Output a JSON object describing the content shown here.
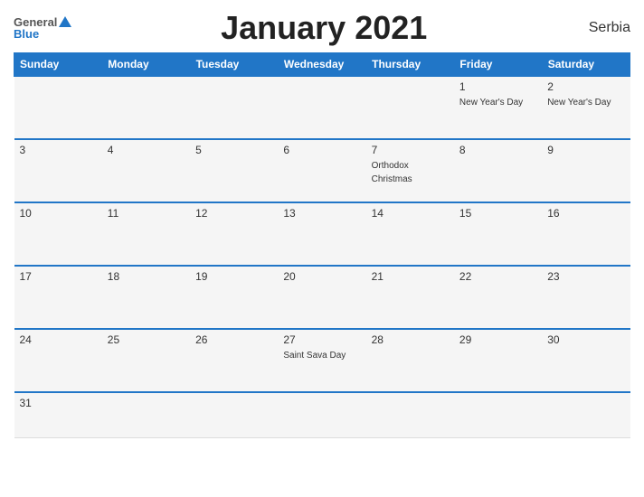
{
  "header": {
    "logo_general": "General",
    "logo_blue": "Blue",
    "title": "January 2021",
    "country": "Serbia"
  },
  "calendar": {
    "days_of_week": [
      "Sunday",
      "Monday",
      "Tuesday",
      "Wednesday",
      "Thursday",
      "Friday",
      "Saturday"
    ],
    "weeks": [
      [
        {
          "day": "",
          "event": ""
        },
        {
          "day": "",
          "event": ""
        },
        {
          "day": "",
          "event": ""
        },
        {
          "day": "",
          "event": ""
        },
        {
          "day": "",
          "event": ""
        },
        {
          "day": "1",
          "event": "New Year's Day"
        },
        {
          "day": "2",
          "event": "New Year's Day"
        }
      ],
      [
        {
          "day": "3",
          "event": ""
        },
        {
          "day": "4",
          "event": ""
        },
        {
          "day": "5",
          "event": ""
        },
        {
          "day": "6",
          "event": ""
        },
        {
          "day": "7",
          "event": "Orthodox Christmas"
        },
        {
          "day": "8",
          "event": ""
        },
        {
          "day": "9",
          "event": ""
        }
      ],
      [
        {
          "day": "10",
          "event": ""
        },
        {
          "day": "11",
          "event": ""
        },
        {
          "day": "12",
          "event": ""
        },
        {
          "day": "13",
          "event": ""
        },
        {
          "day": "14",
          "event": ""
        },
        {
          "day": "15",
          "event": ""
        },
        {
          "day": "16",
          "event": ""
        }
      ],
      [
        {
          "day": "17",
          "event": ""
        },
        {
          "day": "18",
          "event": ""
        },
        {
          "day": "19",
          "event": ""
        },
        {
          "day": "20",
          "event": ""
        },
        {
          "day": "21",
          "event": ""
        },
        {
          "day": "22",
          "event": ""
        },
        {
          "day": "23",
          "event": ""
        }
      ],
      [
        {
          "day": "24",
          "event": ""
        },
        {
          "day": "25",
          "event": ""
        },
        {
          "day": "26",
          "event": ""
        },
        {
          "day": "27",
          "event": "Saint Sava Day"
        },
        {
          "day": "28",
          "event": ""
        },
        {
          "day": "29",
          "event": ""
        },
        {
          "day": "30",
          "event": ""
        }
      ],
      [
        {
          "day": "31",
          "event": ""
        },
        {
          "day": "",
          "event": ""
        },
        {
          "day": "",
          "event": ""
        },
        {
          "day": "",
          "event": ""
        },
        {
          "day": "",
          "event": ""
        },
        {
          "day": "",
          "event": ""
        },
        {
          "day": "",
          "event": ""
        }
      ]
    ]
  }
}
